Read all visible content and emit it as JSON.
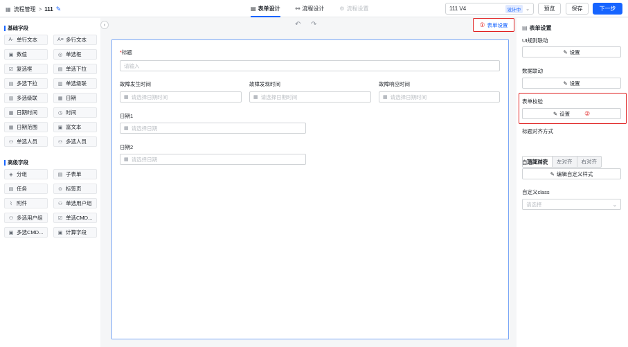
{
  "header": {
    "breadcrumb_root": "流程管理",
    "breadcrumb_sep": ">",
    "process_name": "111",
    "tabs": [
      {
        "label": "表单设计",
        "icon": "form-icon",
        "state": "active"
      },
      {
        "label": "流程设计",
        "icon": "flow-icon",
        "state": "normal"
      },
      {
        "label": "流程设置",
        "icon": "gear-icon",
        "state": "disabled"
      }
    ],
    "version_value": "111 V4",
    "version_badge": "设计中",
    "preview_label": "预览",
    "save_label": "保存",
    "next_label": "下一步"
  },
  "left": {
    "basic_title": "基础字段",
    "basic_fields": [
      {
        "label": "单行文本",
        "icon": "A-"
      },
      {
        "label": "多行文本",
        "icon": "A≡"
      },
      {
        "label": "数值",
        "icon": "▣"
      },
      {
        "label": "单选框",
        "icon": "◎"
      },
      {
        "label": "复选框",
        "icon": "☑"
      },
      {
        "label": "单选下拉",
        "icon": "▤"
      },
      {
        "label": "多选下拉",
        "icon": "▤"
      },
      {
        "label": "单选级联",
        "icon": "▥"
      },
      {
        "label": "多选级联",
        "icon": "▥"
      },
      {
        "label": "日期",
        "icon": "▦"
      },
      {
        "label": "日期时间",
        "icon": "▦"
      },
      {
        "label": "时间",
        "icon": "◷"
      },
      {
        "label": "日期范围",
        "icon": "▦"
      },
      {
        "label": "富文本",
        "icon": "▣"
      },
      {
        "label": "单选人员",
        "icon": "⚇"
      },
      {
        "label": "多选人员",
        "icon": "⚇"
      }
    ],
    "advanced_title": "高级字段",
    "advanced_fields": [
      {
        "label": "分组",
        "icon": "◈"
      },
      {
        "label": "子表单",
        "icon": "▤"
      },
      {
        "label": "任务",
        "icon": "▤"
      },
      {
        "label": "标签页",
        "icon": "⊙"
      },
      {
        "label": "附件",
        "icon": "⌇"
      },
      {
        "label": "单选用户组",
        "icon": "⚇"
      },
      {
        "label": "多选用户组",
        "icon": "⚇"
      },
      {
        "label": "单选CMD...",
        "icon": "☑"
      },
      {
        "label": "多选CMD...",
        "icon": "▣"
      },
      {
        "label": "计算字段",
        "icon": "▣"
      }
    ]
  },
  "toolbar": {
    "form_settings_num": "①",
    "form_settings_label": "表单设置"
  },
  "form": {
    "title_label": "标题",
    "title_placeholder": "请输入",
    "fault_occur_label": "故障发生时间",
    "fault_found_label": "故障发现时间",
    "fault_response_label": "故障响应时间",
    "datetime_placeholder": "请选择日期时间",
    "date1_label": "日期1",
    "date2_label": "日期2",
    "date_placeholder": "请选择日期"
  },
  "right": {
    "title": "表单设置",
    "ui_rule_label": "UI规则联动",
    "data_link_label": "数据联动",
    "validation_label": "表单校验",
    "settings_btn": "设置",
    "validation_num": "②",
    "align_label": "标题对齐方式",
    "align_options": [
      "顶部对齐",
      "左对齐",
      "右对齐"
    ],
    "custom_style_label": "自定义样式",
    "custom_style_btn": "编辑自定义样式",
    "custom_class_label": "自定义class",
    "custom_class_placeholder": "请选择"
  }
}
